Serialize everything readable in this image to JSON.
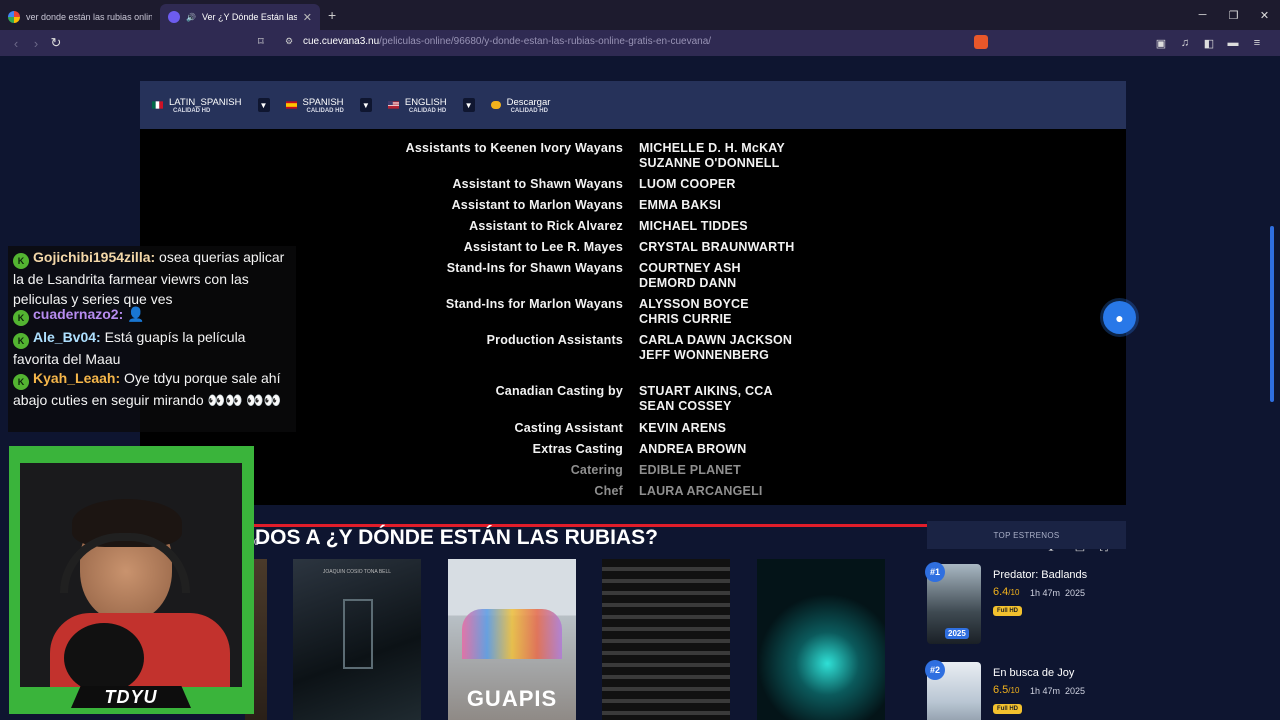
{
  "browser": {
    "tabs": [
      {
        "title": "ver donde están las rubias online cue",
        "active": false
      },
      {
        "title": "Ver ¿Y Dónde Están las Rubias?",
        "active": true
      }
    ],
    "new_tab": "+",
    "url_host": "cue.cuevana3.nu",
    "url_path": "/peliculas-online/96680/y-donde-estan-las-rubias-online-gratis-en-cuevana/"
  },
  "player": {
    "languages": [
      {
        "name": "LATIN_SPANISH",
        "quality": "CALIDAD HD",
        "flag": "mx"
      },
      {
        "name": "SPANISH",
        "quality": "CALIDAD HD",
        "flag": "es"
      },
      {
        "name": "ENGLISH",
        "quality": "CALIDAD HD",
        "flag": "us"
      },
      {
        "name": "Descargar",
        "quality": "CALIDAD HD",
        "flag": "dl"
      }
    ],
    "credits": [
      {
        "role": "Assistants to Keenen Ivory Wayans",
        "names": [
          "MICHELLE D. H. McKAY",
          "SUZANNE O'DONNELL"
        ]
      },
      {
        "role": "Assistant to Shawn Wayans",
        "names": [
          "LUOM COOPER"
        ]
      },
      {
        "role": "Assistant to Marlon Wayans",
        "names": [
          "EMMA BAKSI"
        ]
      },
      {
        "role": "Assistant to Rick Alvarez",
        "names": [
          "MICHAEL TIDDES"
        ]
      },
      {
        "role": "Assistant to Lee R. Mayes",
        "names": [
          "CRYSTAL BRAUNWARTH"
        ]
      },
      {
        "role": "Stand-Ins for Shawn Wayans",
        "names": [
          "COURTNEY ASH",
          "DEMORD DANN"
        ]
      },
      {
        "role": "Stand-Ins for Marlon Wayans",
        "names": [
          "ALYSSON BOYCE",
          "CHRIS CURRIE"
        ]
      },
      {
        "role": "Production Assistants",
        "names": [
          "CARLA DAWN JACKSON",
          "JEFF WONNENBERG"
        ]
      },
      {
        "role": "Canadian Casting by",
        "names": [
          "STUART AIKINS, CCA",
          "SEAN COSSEY"
        ]
      },
      {
        "role": "Casting Assistant",
        "names": [
          "KEVIN ARENS"
        ]
      },
      {
        "role": "Extras Casting",
        "names": [
          "ANDREA BROWN"
        ]
      },
      {
        "role": "Catering",
        "names": [
          "EDIBLE PLANET"
        ]
      },
      {
        "role": "Chef",
        "names": [
          "LAURA ARCANGELI"
        ]
      }
    ],
    "progress_fraction": 0.975,
    "time_fragment": "0"
  },
  "related": {
    "title": "DOS A ¿Y DÓNDE ESTÁN LAS RUBIAS?",
    "posters": [
      {
        "title": "",
        "credit": ""
      },
      {
        "title": "",
        "credit": "JOAQUIN COSIO      TONA BELL"
      },
      {
        "title": "GUAPIS",
        "credit": ""
      },
      {
        "title": "",
        "credit": ""
      },
      {
        "title": "",
        "credit": ""
      }
    ]
  },
  "top_estrenos": {
    "header": "TOP ESTRENOS",
    "items": [
      {
        "rank": "#1",
        "title": "Predator: Badlands",
        "rating": "6.4",
        "scale": "/10",
        "duration": "1h 47m",
        "year": "2025",
        "thumb_year": "2025",
        "badge": "Full HD"
      },
      {
        "rank": "#2",
        "title": "En busca de Joy",
        "rating": "6.5",
        "scale": "/10",
        "duration": "1h 47m",
        "year": "2025",
        "thumb_year": "",
        "badge": "Full HD"
      }
    ]
  },
  "chat": {
    "messages": [
      {
        "user": "Gojichibi1954zilla:",
        "color": "#f3d7a8",
        "text": "osea querias aplicar la de Lsandrita farmear viewrs con las peliculas y series que ves"
      },
      {
        "user": "cuadernazo2:",
        "color": "#b78cf0",
        "text": "👤"
      },
      {
        "user": "Ale_Bv04:",
        "color": "#aee0ff",
        "text": "Está guapís la película favorita del Maau"
      },
      {
        "user": "Kyah_Leaah:",
        "color": "#f5b64a",
        "text": "Oye tdyu porque sale ahí abajo cuties en seguir mirando 👀👀 👀👀"
      }
    ]
  },
  "webcam": {
    "label": "TDYU"
  }
}
